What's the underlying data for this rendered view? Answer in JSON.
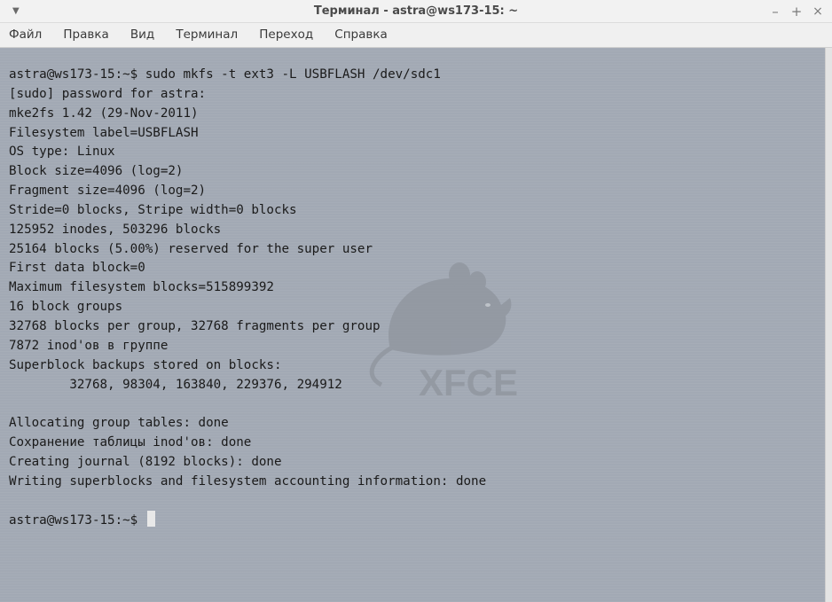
{
  "window": {
    "title": "Терминал - astra@ws173-15: ~",
    "menu_icon": "▼",
    "minimize": "–",
    "maximize": "+",
    "close": "×"
  },
  "menu": {
    "file": "Файл",
    "edit": "Правка",
    "view": "Вид",
    "terminal": "Терминал",
    "go": "Переход",
    "help": "Справка"
  },
  "terminal": {
    "background_color": "#a2a9b4",
    "watermark": "XFCE",
    "lines": [
      "astra@ws173-15:~$ sudo mkfs -t ext3 -L USBFLASH /dev/sdc1",
      "[sudo] password for astra:",
      "mke2fs 1.42 (29-Nov-2011)",
      "Filesystem label=USBFLASH",
      "OS type: Linux",
      "Block size=4096 (log=2)",
      "Fragment size=4096 (log=2)",
      "Stride=0 blocks, Stripe width=0 blocks",
      "125952 inodes, 503296 blocks",
      "25164 blocks (5.00%) reserved for the super user",
      "First data block=0",
      "Maximum filesystem blocks=515899392",
      "16 block groups",
      "32768 blocks per group, 32768 fragments per group",
      "7872 inod'ов в группе",
      "Superblock backups stored on blocks:",
      "        32768, 98304, 163840, 229376, 294912",
      "",
      "Allocating group tables: done",
      "Сохранение таблицы inod'ов: done",
      "Creating journal (8192 blocks): done",
      "Writing superblocks and filesystem accounting information: done",
      "",
      "astra@ws173-15:~$ "
    ]
  }
}
